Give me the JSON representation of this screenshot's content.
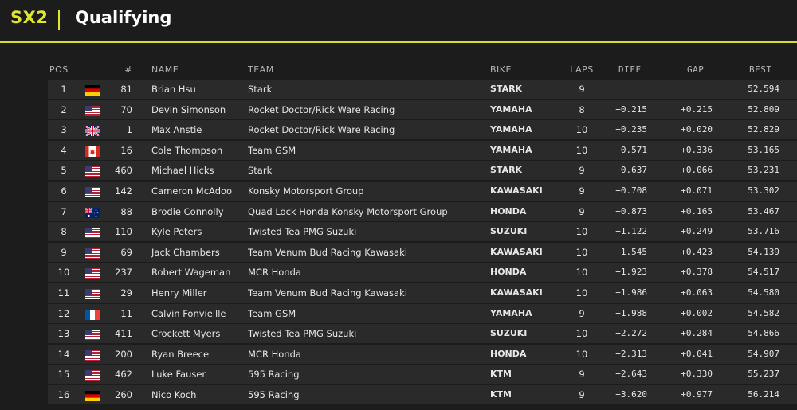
{
  "header": {
    "class_label": "SX2",
    "session_title": "Qualifying"
  },
  "columns": {
    "pos": "POS",
    "num": "#",
    "name": "NAME",
    "team": "TEAM",
    "bike": "BIKE",
    "laps": "LAPS",
    "diff": "DIFF",
    "gap": "GAP",
    "best": "BEST"
  },
  "rows": [
    {
      "pos": "1",
      "flag": "de",
      "num": "81",
      "name": "Brian Hsu",
      "team": "Stark",
      "bike": "STARK",
      "laps": "9",
      "diff": "",
      "gap": "",
      "best": "52.594"
    },
    {
      "pos": "2",
      "flag": "us",
      "num": "70",
      "name": "Devin Simonson",
      "team": "Rocket Doctor/Rick Ware Racing",
      "bike": "YAMAHA",
      "laps": "8",
      "diff": "+0.215",
      "gap": "+0.215",
      "best": "52.809"
    },
    {
      "pos": "3",
      "flag": "gb",
      "num": "1",
      "name": "Max Anstie",
      "team": "Rocket Doctor/Rick Ware Racing",
      "bike": "YAMAHA",
      "laps": "10",
      "diff": "+0.235",
      "gap": "+0.020",
      "best": "52.829"
    },
    {
      "pos": "4",
      "flag": "ca",
      "num": "16",
      "name": "Cole Thompson",
      "team": "Team GSM",
      "bike": "YAMAHA",
      "laps": "10",
      "diff": "+0.571",
      "gap": "+0.336",
      "best": "53.165"
    },
    {
      "pos": "5",
      "flag": "us",
      "num": "460",
      "name": "Michael Hicks",
      "team": "Stark",
      "bike": "STARK",
      "laps": "9",
      "diff": "+0.637",
      "gap": "+0.066",
      "best": "53.231"
    },
    {
      "pos": "6",
      "flag": "us",
      "num": "142",
      "name": "Cameron McAdoo",
      "team": "Konsky Motorsport Group",
      "bike": "KAWASAKI",
      "laps": "9",
      "diff": "+0.708",
      "gap": "+0.071",
      "best": "53.302"
    },
    {
      "pos": "7",
      "flag": "au",
      "num": "88",
      "name": "Brodie Connolly",
      "team": "Quad Lock Honda Konsky Motorsport Group",
      "bike": "HONDA",
      "laps": "9",
      "diff": "+0.873",
      "gap": "+0.165",
      "best": "53.467"
    },
    {
      "pos": "8",
      "flag": "us",
      "num": "110",
      "name": "Kyle Peters",
      "team": "Twisted Tea PMG Suzuki",
      "bike": "SUZUKI",
      "laps": "10",
      "diff": "+1.122",
      "gap": "+0.249",
      "best": "53.716"
    },
    {
      "pos": "9",
      "flag": "us",
      "num": "69",
      "name": "Jack Chambers",
      "team": "Team Venum Bud Racing Kawasaki",
      "bike": "KAWASAKI",
      "laps": "10",
      "diff": "+1.545",
      "gap": "+0.423",
      "best": "54.139"
    },
    {
      "pos": "10",
      "flag": "us",
      "num": "237",
      "name": "Robert Wageman",
      "team": "MCR Honda",
      "bike": "HONDA",
      "laps": "10",
      "diff": "+1.923",
      "gap": "+0.378",
      "best": "54.517"
    },
    {
      "pos": "11",
      "flag": "us",
      "num": "29",
      "name": "Henry Miller",
      "team": "Team Venum Bud Racing Kawasaki",
      "bike": "KAWASAKI",
      "laps": "10",
      "diff": "+1.986",
      "gap": "+0.063",
      "best": "54.580"
    },
    {
      "pos": "12",
      "flag": "fr",
      "num": "11",
      "name": "Calvin Fonvieille",
      "team": "Team GSM",
      "bike": "YAMAHA",
      "laps": "9",
      "diff": "+1.988",
      "gap": "+0.002",
      "best": "54.582"
    },
    {
      "pos": "13",
      "flag": "us",
      "num": "411",
      "name": "Crockett Myers",
      "team": "Twisted Tea PMG Suzuki",
      "bike": "SUZUKI",
      "laps": "10",
      "diff": "+2.272",
      "gap": "+0.284",
      "best": "54.866"
    },
    {
      "pos": "14",
      "flag": "us",
      "num": "200",
      "name": "Ryan Breece",
      "team": "MCR Honda",
      "bike": "HONDA",
      "laps": "10",
      "diff": "+2.313",
      "gap": "+0.041",
      "best": "54.907"
    },
    {
      "pos": "15",
      "flag": "us",
      "num": "462",
      "name": "Luke Fauser",
      "team": "595 Racing",
      "bike": "KTM",
      "laps": "9",
      "diff": "+2.643",
      "gap": "+0.330",
      "best": "55.237"
    },
    {
      "pos": "16",
      "flag": "de",
      "num": "260",
      "name": "Nico Koch",
      "team": "595 Racing",
      "bike": "KTM",
      "laps": "9",
      "diff": "+3.620",
      "gap": "+0.977",
      "best": "56.214"
    }
  ],
  "colors": {
    "accent": "#dfe62e",
    "background": "#1c1c1c",
    "row": "#2a2a2a"
  }
}
